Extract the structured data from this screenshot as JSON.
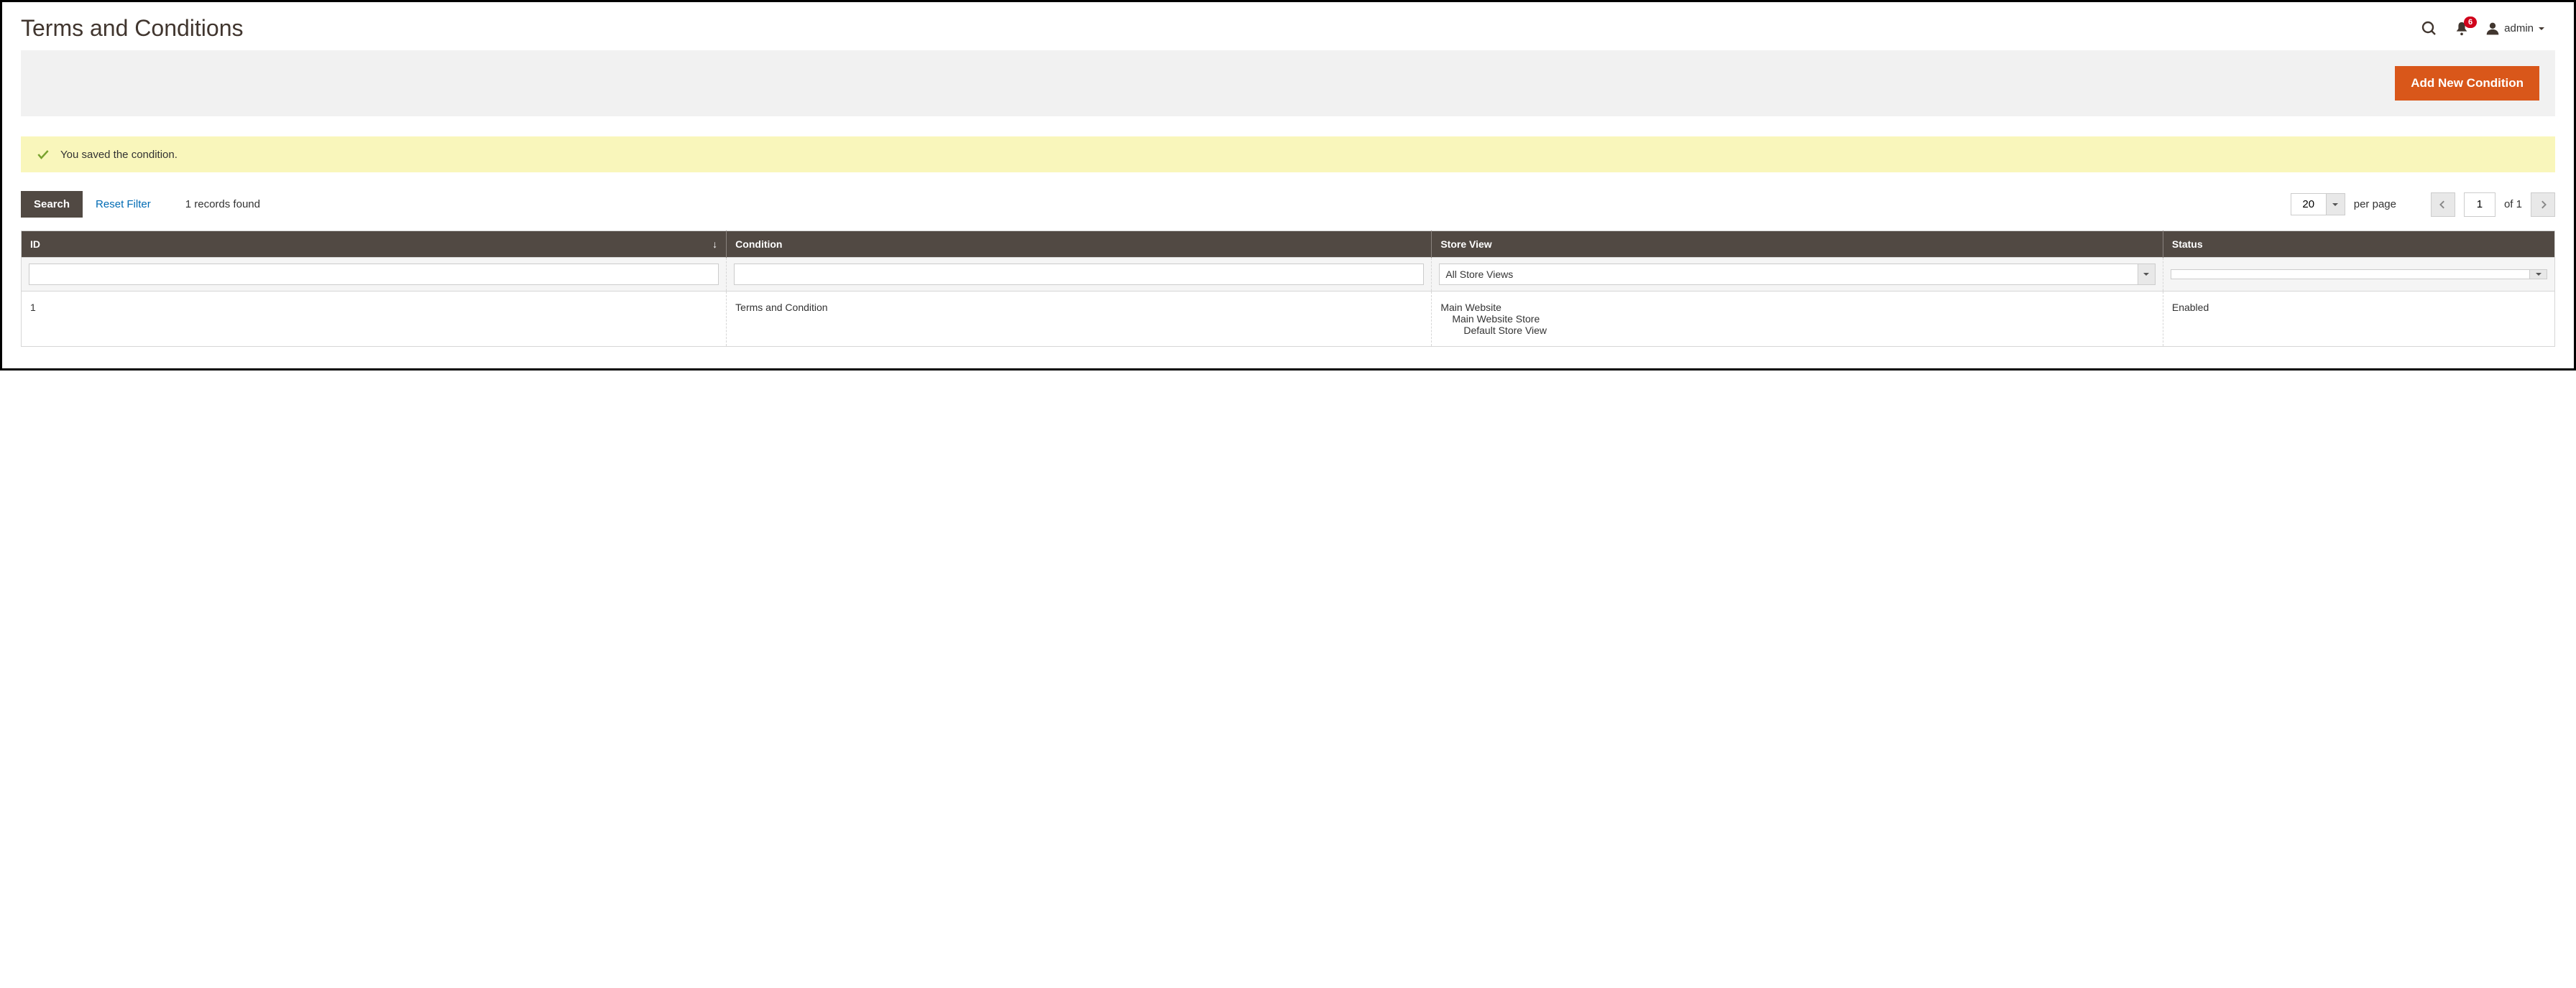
{
  "header": {
    "title": "Terms and Conditions",
    "notification_count": "6",
    "user_name": "admin"
  },
  "actions": {
    "add_button": "Add New Condition"
  },
  "message": {
    "text": "You saved the condition."
  },
  "grid_controls": {
    "search_label": "Search",
    "reset_label": "Reset Filter",
    "records_found": "1 records found",
    "per_page_value": "20",
    "per_page_label": "per page",
    "current_page": "1",
    "of_label": "of 1"
  },
  "columns": {
    "id": "ID",
    "condition": "Condition",
    "store_view": "Store View",
    "status": "Status"
  },
  "filters": {
    "id": "",
    "condition": "",
    "store_view_selected": "All Store Views",
    "status_selected": ""
  },
  "rows": [
    {
      "id": "1",
      "condition": "Terms and Condition",
      "store_l1": "Main Website",
      "store_l2": "Main Website Store",
      "store_l3": "Default Store View",
      "status": "Enabled"
    }
  ]
}
